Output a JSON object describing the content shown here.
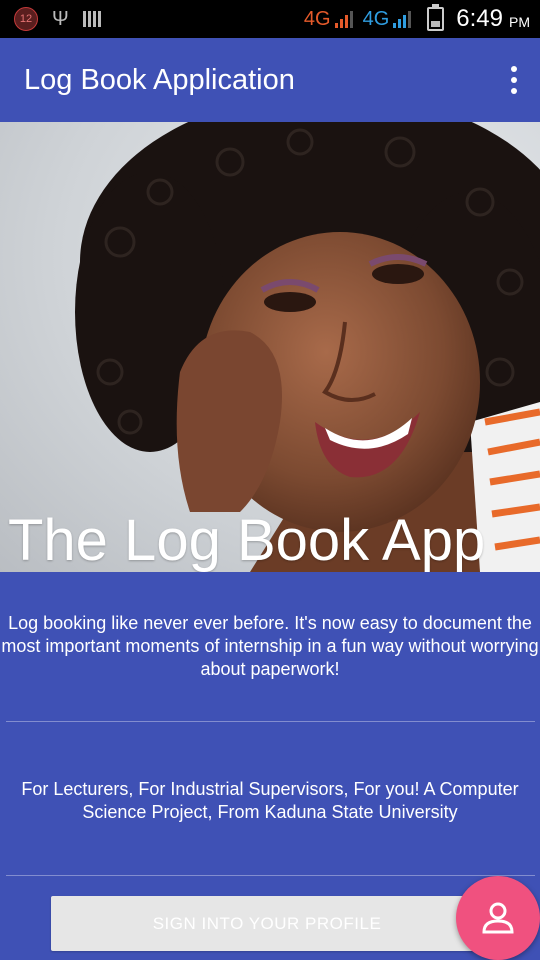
{
  "status_bar": {
    "notification_count": "12",
    "network_1": "4G",
    "network_2": "4G",
    "time": "6:49",
    "ampm": "PM",
    "colors": {
      "network_1": "#e55a2a",
      "network_2": "#2f9de0"
    }
  },
  "app_bar": {
    "title": "Log Book Application",
    "menu_icon": "overflow-menu-icon"
  },
  "hero": {
    "title": "The Log Book App",
    "image": "photo-of-smiling-woman"
  },
  "content": {
    "intro": "Log booking like never ever before. It's now easy to document the most important moments of internship in a fun way without worrying about paperwork!",
    "credits": "For Lecturers, For Industrial Supervisors, For you! A Computer Science Project, From Kaduna State University",
    "sign_in_label": "SIGN INTO YOUR PROFILE",
    "fab_icon": "person-icon"
  },
  "colors": {
    "primary": "#3F51B5",
    "accent": "#F0517F",
    "button_bg": "#e6e6e6"
  }
}
